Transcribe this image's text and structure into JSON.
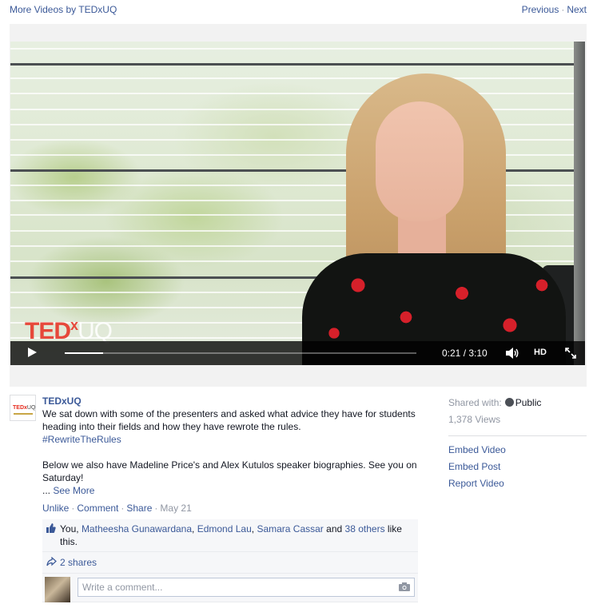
{
  "topbar": {
    "more_videos": "More Videos by TEDxUQ",
    "previous": "Previous",
    "separator": "·",
    "next": "Next"
  },
  "video": {
    "watermark_ted": "TED",
    "watermark_x": "x",
    "watermark_uq": "UQ",
    "time": "0:21 / 3:10",
    "hd_label": "HD",
    "progress_fraction": 0.11,
    "icons": [
      "play-icon",
      "volume-icon",
      "fullscreen-icon"
    ]
  },
  "post": {
    "avatar_logo_ted": "TEDx",
    "avatar_logo_uq": "UQ",
    "author": "TEDxUQ",
    "text_line1": "We sat down with some of the presenters and asked what advice they have for students heading into their fields and how they have rewrote the rules.",
    "hashtag": "#RewriteTheRules",
    "text_line2": "Below we also have Madeline Price's and Alex Kutulos speaker biographies. See you on Saturday!",
    "see_more_prefix": "...",
    "see_more": "See More",
    "actions": {
      "unlike": "Unlike",
      "comment": "Comment",
      "share": "Share",
      "date": "May 21",
      "sep": "·"
    }
  },
  "ufi": {
    "likes_you": "You,",
    "liker1": "Matheesha Gunawardana",
    "liker2": "Edmond Lau",
    "liker3": "Samara Cassar",
    "and_text": "and",
    "others": "38 others",
    "likes_suffix": "like this.",
    "shares": "2 shares",
    "comment_placeholder": "Write a comment..."
  },
  "sidebar": {
    "shared_with": "Shared with:",
    "public": "Public",
    "views": "1,378 Views",
    "embed_video": "Embed Video",
    "embed_post": "Embed Post",
    "report_video": "Report Video"
  },
  "colors": {
    "link": "#3b5998",
    "muted": "#9197a3",
    "ted_red": "#e62b1e"
  }
}
